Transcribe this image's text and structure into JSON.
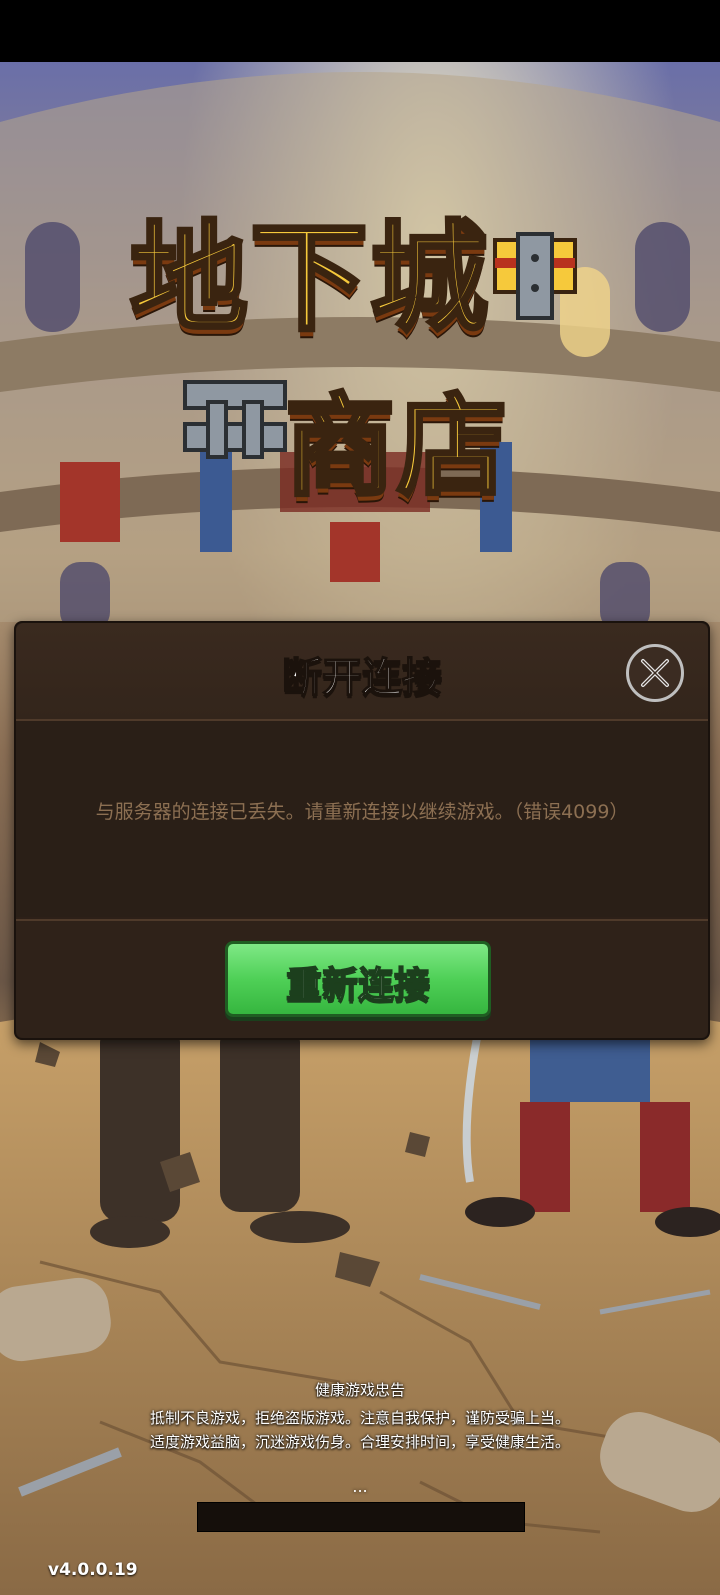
{
  "game": {
    "logo_line1": "地下城",
    "logo_line2": "商店"
  },
  "dialog": {
    "title": "断开连接",
    "message": "与服务器的连接已丢失。请重新连接以继续游戏。（错误4099）",
    "reconnect_label": "重新连接",
    "close_icon": "close-icon"
  },
  "notice": {
    "title": "健康游戏忠告",
    "line1": "抵制不良游戏，拒绝盗版游戏。注意自我保护，谨防受骗上当。",
    "line2": "适度游戏益脑，沉迷游戏伤身。合理安排时间，享受健康生活。"
  },
  "loading": {
    "dots": "...",
    "progress": 0
  },
  "version": "v4.0.0.19"
}
